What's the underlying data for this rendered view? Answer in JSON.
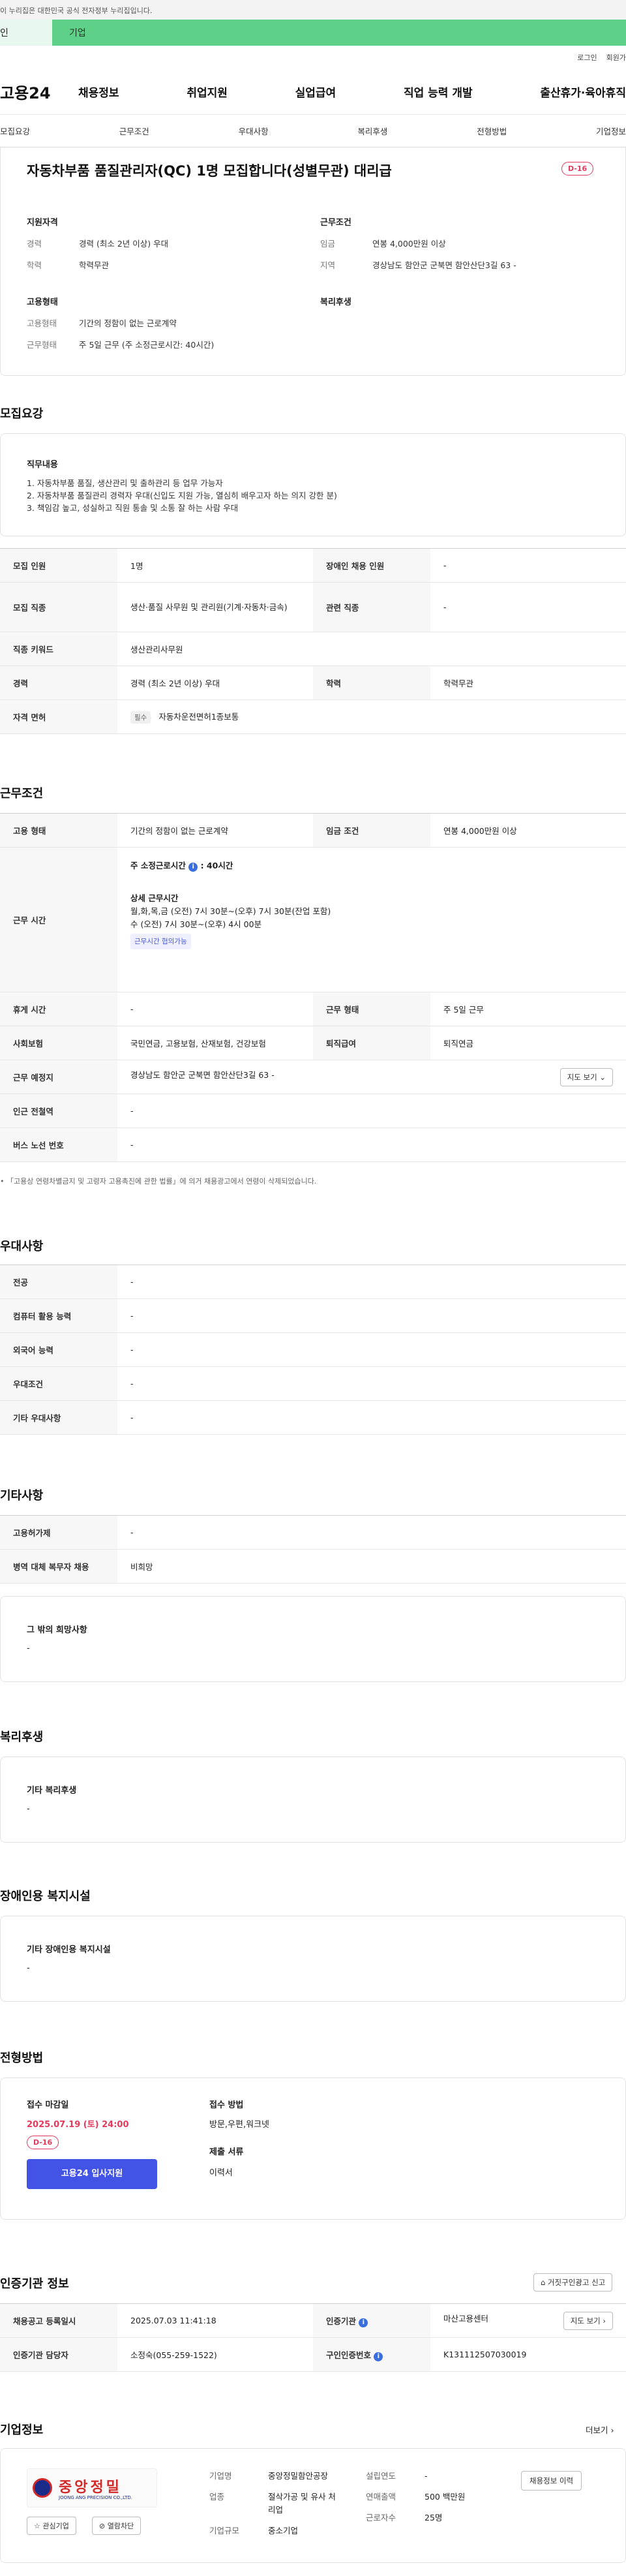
{
  "gov_notice": "이 누리집은 대한민국 공식 전자정부 누리집입니다.",
  "ad": {
    "left": "인",
    "right": "기업"
  },
  "util": {
    "login": "로그인",
    "join": "회원가"
  },
  "gnb": {
    "logo": "고용24",
    "menu": [
      "채용정보",
      "취업지원",
      "실업급여",
      "직업 능력 개발",
      "출산휴가·육아휴직"
    ]
  },
  "tabs": [
    "모집요강",
    "근무조건",
    "우대사항",
    "복리후생",
    "전형방법",
    "기업정보"
  ],
  "summary": {
    "title": "자동차부품 품질관리자(QC) 1명 모집합니다(성별무관) 대리급",
    "dday": "D-16",
    "qual": {
      "heading": "지원자격",
      "rows": [
        {
          "k": "경력",
          "v": "경력 (최소 2년 이상) 우대"
        },
        {
          "k": "학력",
          "v": "학력무관"
        }
      ]
    },
    "cond": {
      "heading": "근무조건",
      "rows": [
        {
          "k": "임금",
          "v": "연봉 4,000만원 이상"
        },
        {
          "k": "지역",
          "v": "경상남도 함안군 군북면 함안산단3길 63 -"
        }
      ]
    },
    "emp": {
      "heading": "고용형태",
      "rows": [
        {
          "k": "고용형태",
          "v": "기간의 정함이 없는 근로계약"
        },
        {
          "k": "근무형태",
          "v": "주 5일 근무 (주 소정근로시간: 40시간)"
        }
      ]
    },
    "welfare": {
      "heading": "복리후생"
    }
  },
  "recruit": {
    "title": "모집요강",
    "duty_heading": "직무내용",
    "duty_lines": [
      "1. 자동차부품 품질, 생산관리 및 출하관리 등 업무 가능자",
      "2. 자동차부품 품질관리 경력자 우대(신입도 지원 가능, 열심히 배우고자 하는 의지 강한 분)",
      "3. 책임감 높고, 성실하고 직원 통솔 및 소통 잘 하는 사람 우대"
    ],
    "rows": {
      "count_k": "모집 인원",
      "count_v": "1명",
      "disabled_k": "장애인 채용 인원",
      "disabled_v": "-",
      "job_k": "모집 직종",
      "job_v": "생산·품질 사무원 및 관리원(기계·자동차·금속)",
      "related_k": "관련 직종",
      "related_v": "-",
      "keyword_k": "직종 키워드",
      "keyword_v": "생산관리사무원",
      "career_k": "경력",
      "career_v": "경력 (최소 2년 이상) 우대",
      "edu_k": "학력",
      "edu_v": "학력무관",
      "license_k": "자격 면허",
      "license_tag": "필수",
      "license_v": "자동차운전면허1종보통"
    }
  },
  "workcond": {
    "title": "근무조건",
    "emp_k": "고용 형태",
    "emp_v": "기간의 정함이 없는 근로계약",
    "wage_k": "임금 조건",
    "wage_v": "연봉 4,000만원 이상",
    "time_k": "근무 시간",
    "time_main": "주 소정근로시간",
    "time_main_v": ": 40시간",
    "time_detail_h": "상세 근무시간",
    "time_detail_1": "월,화,목,금  (오전) 7시 30분~(오후) 7시 30분(잔업 포함)",
    "time_detail_2": "수  (오전) 7시 30분~(오후) 4시 00분",
    "time_tag": "근무시간 협의가능",
    "rest_k": "휴게 시간",
    "rest_v": "-",
    "form_k": "근무 형태",
    "form_v": "주 5일 근무",
    "ins_k": "사회보험",
    "ins_v": "국민연금, 고용보험, 산재보험, 건강보험",
    "retire_k": "퇴직급여",
    "retire_v": "퇴직연금",
    "place_k": "근무 예정지",
    "place_v": "경상남도 함안군 군북면 함안산단3길 63 -",
    "map_btn": "지도 보기",
    "station_k": "인근 전철역",
    "station_v": "-",
    "bus_k": "버스 노선 번호",
    "bus_v": "-",
    "note": "「고용상 연령차별금지 및 고령자 고용촉진에 관한 법률」에 의거 채용광고에서 연령이 삭제되었습니다."
  },
  "pref": {
    "title": "우대사항",
    "rows": [
      {
        "k": "전공",
        "v": "-"
      },
      {
        "k": "컴퓨터 활용 능력",
        "v": "-"
      },
      {
        "k": "외국어 능력",
        "v": "-"
      },
      {
        "k": "우대조건",
        "v": "-"
      },
      {
        "k": "기타 우대사항",
        "v": "-"
      }
    ]
  },
  "etc": {
    "title": "기타사항",
    "rows": [
      {
        "k": "고용허가제",
        "v": "-"
      },
      {
        "k": "병역 대체 복무자 채용",
        "v": "비희망"
      }
    ],
    "other_h": "그 밖의 희망사항",
    "other_v": "-"
  },
  "welfare": {
    "title": "복리후생",
    "h": "기타 복리후생",
    "v": "-"
  },
  "disab": {
    "title": "장애인용 복지시설",
    "h": "기타 장애인용 복지시설",
    "v": "-"
  },
  "process": {
    "title": "전형방법",
    "deadline_h": "접수 마감일",
    "deadline_v": "2025.07.19 (토) 24:00",
    "dday": "D-16",
    "apply_btn": "고용24 입사지원",
    "method_h": "접수 방법",
    "method_v": "방문,우편,워크넷",
    "docs_h": "제출 서류",
    "docs_v": "이력서"
  },
  "cert": {
    "title": "인증기관 정보",
    "report_btn": "거짓구인광고 신고",
    "reg_k": "채용공고 등록일시",
    "reg_v": "2025.07.03 11:41:18",
    "org_k": "인증기관",
    "org_v": "마산고용센터",
    "map_btn": "지도 보기",
    "mgr_k": "인증기관 담당자",
    "mgr_v": "소정숙(055-259-1522)",
    "no_k": "구인인증번호",
    "no_v": "K131112507030019"
  },
  "company": {
    "title": "기업정보",
    "more": "더보기",
    "logo_text": "중앙정밀",
    "logo_sub": "JOONG ANG PRECISION CO.,LTD.",
    "fav_btn": "관심기업",
    "block_btn": "열람차단",
    "name_k": "기업명",
    "name_v": "중앙정밀함안공장",
    "ind_k": "업종",
    "ind_v": "절삭가공 및 유사 처리업",
    "size_k": "기업규모",
    "size_v": "중소기업",
    "year_k": "설립연도",
    "year_v": "-",
    "sales_k": "연매출액",
    "sales_v": "500 백만원",
    "emp_k": "근로자수",
    "emp_v": "25명",
    "history_btn": "채용정보 이력"
  },
  "colors": {
    "accent": "#4353e5",
    "red": "#e23a5c",
    "green": "#5ed087"
  }
}
